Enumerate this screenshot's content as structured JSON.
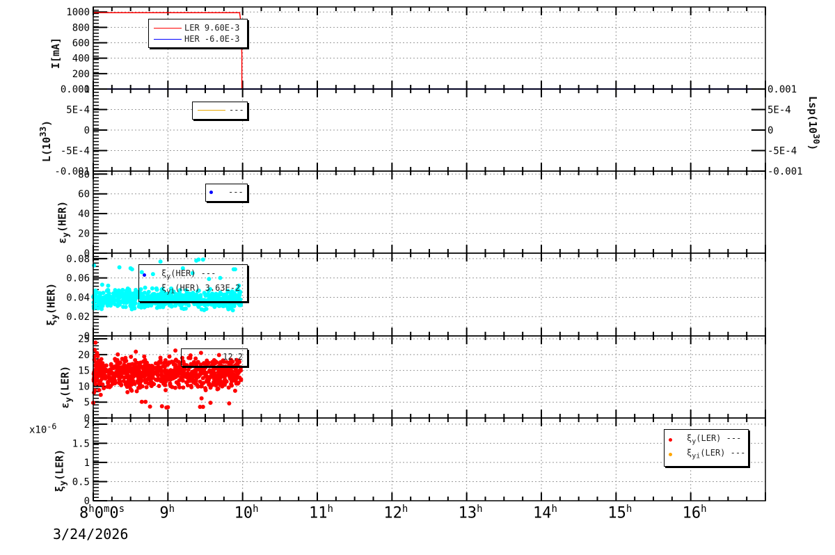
{
  "chart_data": [
    {
      "type": "line",
      "panel": "current",
      "ylabel": "I[mA]",
      "ylim": [
        0,
        1065
      ],
      "yticks": [
        0,
        200,
        400,
        600,
        800,
        1000
      ],
      "series": [
        {
          "name": "LER",
          "legend_value": "9.60E-3",
          "color": "#ff0000",
          "x": [
            8.0,
            9.96,
            9.97,
            9.98,
            9.99,
            9.99
          ],
          "y": [
            990,
            990,
            920,
            800,
            450,
            0
          ]
        },
        {
          "name": "HER",
          "legend_value": "-6.0E-3",
          "color": "#0000ff",
          "x": [
            8.0,
            17.0
          ],
          "y": [
            0,
            0
          ]
        }
      ]
    },
    {
      "type": "line",
      "panel": "luminosity",
      "ylabel": "L(10^33)",
      "ylabel_right": "Lsp(10^30)",
      "ylim": [
        -0.001,
        0.001
      ],
      "yticks": [
        "-0.001",
        "-5E-4",
        "0",
        "5E-4",
        "0.001"
      ],
      "series": [
        {
          "name": "",
          "legend_value": "---",
          "color": "#e8a800",
          "x": [],
          "y": []
        }
      ]
    },
    {
      "type": "scatter",
      "panel": "emittance_her",
      "ylabel": "εy(HER)",
      "ylim": [
        0,
        83
      ],
      "yticks": [
        0,
        20,
        40,
        60,
        80
      ],
      "series": [
        {
          "name": "",
          "legend_value": "---",
          "color": "#0000ff",
          "x": [],
          "y": []
        }
      ]
    },
    {
      "type": "scatter",
      "panel": "xi_her",
      "ylabel": "ξy(HER)",
      "ylim": [
        0,
        0.0857
      ],
      "yticks": [
        "0",
        "0.02",
        "0.04",
        "0.06",
        "0.08"
      ],
      "series": [
        {
          "name": "ξy(HER)",
          "legend_value": "---",
          "color": "#0000ff",
          "x": [],
          "y": []
        },
        {
          "name": "ξyi(HER)",
          "legend_value": "3.63E-2",
          "color": "#00ffff",
          "band": {
            "x_range": [
              8.0,
              9.98
            ],
            "mean": 0.038,
            "spread": 0.0045,
            "n": 700
          },
          "outliers": {
            "x": [
              8.01,
              8.35,
              8.5,
              8.52,
              8.9,
              9.2,
              9.38,
              9.41,
              9.47,
              9.55,
              9.88,
              9.9,
              8.65,
              8.8,
              8.12,
              8.2,
              9.05,
              9.33,
              9.7,
              9.95,
              8.03,
              8.95
            ],
            "y": [
              0.073,
              0.071,
              0.07,
              0.069,
              0.077,
              0.07,
              0.078,
              0.079,
              0.079,
              0.059,
              0.069,
              0.069,
              0.066,
              0.064,
              0.053,
              0.052,
              0.047,
              0.065,
              0.06,
              0.052,
              0.047,
              0.045
            ]
          }
        }
      ]
    },
    {
      "type": "scatter",
      "panel": "emittance_ler",
      "ylabel": "εy(LER)",
      "ylim": [
        0,
        25.9
      ],
      "yticks": [
        0,
        5,
        10,
        15,
        20,
        25
      ],
      "series": [
        {
          "name": "",
          "legend_value": "12.2",
          "color": "#ff0000",
          "band": {
            "x_range": [
              8.0,
              9.98
            ],
            "mean": 14.2,
            "spread": 2.3,
            "n": 800
          },
          "outliers": {
            "x": [
              8.0,
              8.01,
              8.02,
              8.03,
              8.05,
              8.06,
              8.08,
              8.1,
              8.65,
              8.7,
              8.76,
              8.92,
              8.98,
              9.1,
              9.43,
              9.47,
              9.57,
              9.82,
              9.9,
              9.92,
              9.02,
              9.3,
              9.0,
              9.45
            ],
            "y": [
              4.8,
              8,
              21.5,
              23.8,
              20.5,
              19.5,
              8.8,
              7.3,
              5.1,
              5.1,
              3.6,
              3.7,
              3.3,
              21.3,
              3.5,
              3.5,
              4.8,
              4.6,
              8.6,
              18.3,
              19.4,
              18.9,
              3.4,
              6.2
            ]
          }
        }
      ]
    },
    {
      "type": "scatter",
      "panel": "xi_ler",
      "ylabel": "ξy(LER)",
      "ylim": [
        0,
        2.16
      ],
      "yticks": [
        "0",
        "0.5",
        "1",
        "1.5",
        "2"
      ],
      "multiplier": "x10^-6",
      "series": [
        {
          "name": "ξy(LER)",
          "legend_value": "---",
          "color": "#ff0000",
          "x": [],
          "y": []
        },
        {
          "name": "ξyi(LER)",
          "legend_value": "---",
          "color": "#ffa500",
          "x": [],
          "y": []
        }
      ]
    }
  ],
  "x_axis": {
    "range_hours": [
      8,
      17
    ],
    "ticks": [
      "8h0m0s",
      "9h",
      "10h",
      "11h",
      "12h",
      "13h",
      "14h",
      "15h",
      "16h"
    ],
    "date": "3/24/2026"
  },
  "labels": {
    "p1_ylab": "I[mA]",
    "p2_ylab": "L(10",
    "p2_ylab_sup": "33",
    "p2_ylab_end": ")",
    "p2_rlab": "Lsp(10",
    "p2_rlab_sup": "30",
    "p2_rlab_end": ")",
    "p3_ylab": "ε",
    "p3_sub": "y",
    "p3_end": "(HER)",
    "p4_ylab": "ξ",
    "p4_sub": "y",
    "p4_end": "(HER)",
    "p5_ylab": "ε",
    "p5_sub": "y",
    "p5_end": "(LER)",
    "p6_ylab": "ξ",
    "p6_sub": "y",
    "p6_end": "(LER)",
    "mult": "x10",
    "mult_sup": "-6",
    "lg1_a": "LER  9.60E-3",
    "lg1_b": "HER  -6.0E-3",
    "lg2": "---",
    "lg3": "---",
    "lg4_a_name": "ξ",
    "lg4_a_sub": "y",
    "lg4_a_end": "(HER) ---",
    "lg4_b_name": "ξ",
    "lg4_b_sub": "yi",
    "lg4_b_end": "(HER)  3.63E-2",
    "lg5": "12.2",
    "lg6_a_name": "ξ",
    "lg6_a_sub": "y",
    "lg6_a_end": "(LER) ---",
    "lg6_b_name": "ξ",
    "lg6_b_sub": "yi",
    "lg6_b_end": "(LER) ---"
  }
}
